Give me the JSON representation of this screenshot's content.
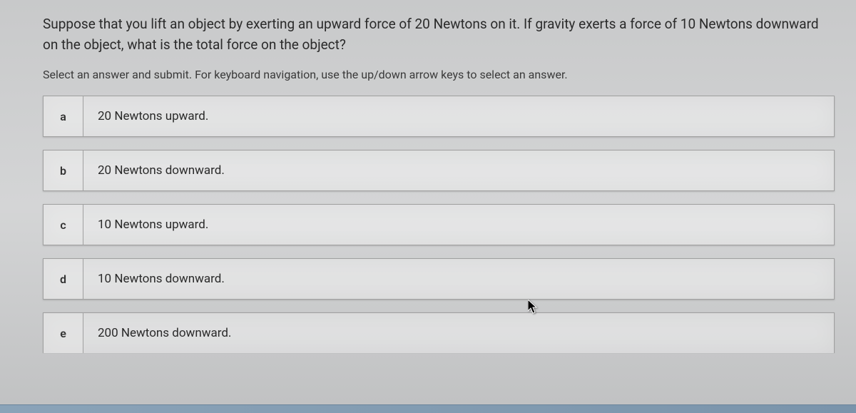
{
  "question": "Suppose that you lift an object by exerting an upward force of 20 Newtons on it. If gravity exerts a force of 10 Newtons downward on the object, what is the total force on the object?",
  "instruction": "Select an answer and submit. For keyboard navigation, use the up/down arrow keys to select an answer.",
  "options": [
    {
      "key": "a",
      "label": "20 Newtons upward."
    },
    {
      "key": "b",
      "label": "20 Newtons downward."
    },
    {
      "key": "c",
      "label": "10 Newtons upward."
    },
    {
      "key": "d",
      "label": "10 Newtons downward."
    },
    {
      "key": "e",
      "label": "200 Newtons downward."
    }
  ]
}
